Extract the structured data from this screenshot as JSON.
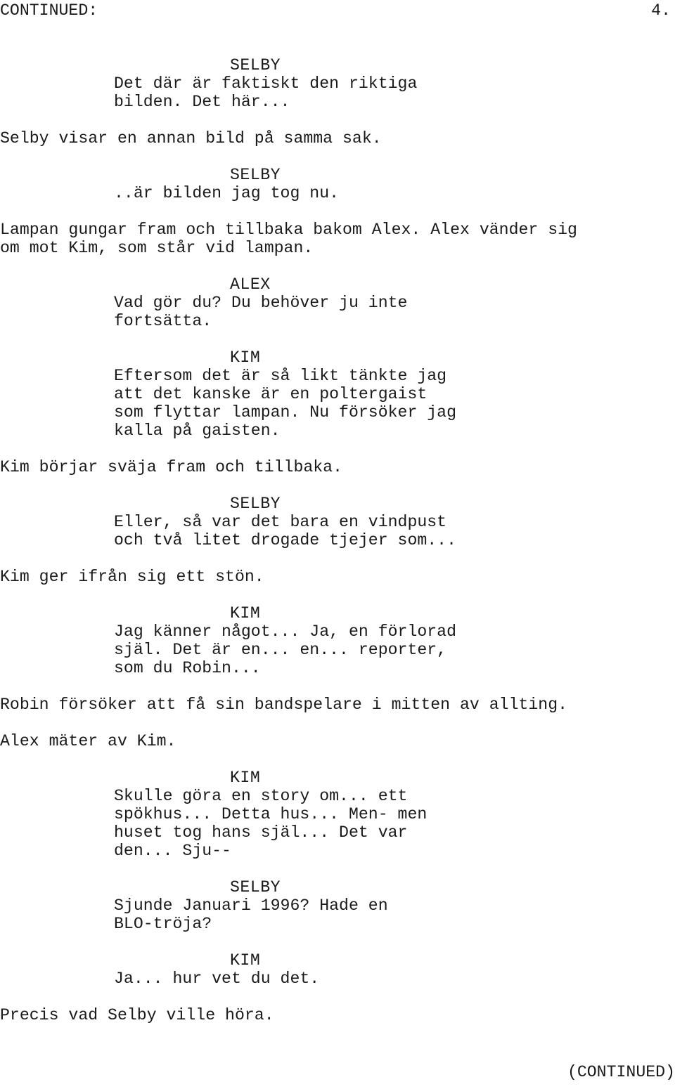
{
  "document": {
    "type": "screenplay-page",
    "language": "sv",
    "header": {
      "continued_label": "CONTINUED:",
      "page_number": "4."
    },
    "footer": {
      "continued_label": "(CONTINUED)"
    },
    "blocks": [
      {
        "kind": "dialogue",
        "character": "SELBY",
        "lines": [
          "Det där är faktiskt den riktiga",
          "bilden. Det här..."
        ]
      },
      {
        "kind": "action",
        "lines": [
          "Selby visar en annan bild på samma sak."
        ]
      },
      {
        "kind": "dialogue",
        "character": "SELBY",
        "lines": [
          "..är bilden jag tog nu."
        ]
      },
      {
        "kind": "action",
        "lines": [
          "Lampan gungar fram och tillbaka bakom Alex. Alex vänder sig",
          "om mot Kim, som står vid lampan."
        ]
      },
      {
        "kind": "dialogue",
        "character": "ALEX",
        "lines": [
          "Vad gör du? Du behöver ju inte",
          "fortsätta."
        ]
      },
      {
        "kind": "dialogue",
        "character": "KIM",
        "lines": [
          "Eftersom det är så likt tänkte jag",
          "att det kanske är en poltergaist",
          "som flyttar lampan. Nu försöker jag",
          "kalla på gaisten."
        ]
      },
      {
        "kind": "action",
        "lines": [
          "Kim börjar sväja fram och tillbaka."
        ]
      },
      {
        "kind": "dialogue",
        "character": "SELBY",
        "lines": [
          "Eller, så var det bara en vindpust",
          "och två litet drogade tjejer som..."
        ]
      },
      {
        "kind": "action",
        "lines": [
          "Kim ger ifrån sig ett stön."
        ]
      },
      {
        "kind": "dialogue",
        "character": "KIM",
        "lines": [
          "Jag känner något... Ja, en förlorad",
          "själ. Det är en... en... reporter,",
          "som du Robin..."
        ]
      },
      {
        "kind": "action",
        "lines": [
          "Robin försöker att få sin bandspelare i mitten av allting."
        ]
      },
      {
        "kind": "action",
        "lines": [
          "Alex mäter av Kim."
        ]
      },
      {
        "kind": "dialogue",
        "character": "KIM",
        "lines": [
          "Skulle göra en story om... ett",
          "spökhus... Detta hus... Men- men",
          "huset tog hans själ... Det var",
          "den... Sju--"
        ]
      },
      {
        "kind": "dialogue",
        "character": "SELBY",
        "lines": [
          "Sjunde Januari 1996? Hade en",
          "BLO-tröja?"
        ]
      },
      {
        "kind": "dialogue",
        "character": "KIM",
        "lines": [
          "Ja... hur vet du det."
        ]
      },
      {
        "kind": "action",
        "lines": [
          "Precis vad Selby ville höra."
        ]
      }
    ]
  }
}
